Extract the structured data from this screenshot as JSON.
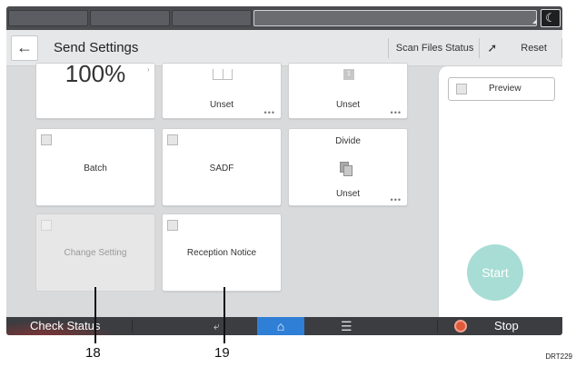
{
  "header": {
    "title": "Send Settings",
    "scan_files_status": "Scan Files Status",
    "reset": "Reset"
  },
  "tiles": {
    "scale": {
      "value": "100%"
    },
    "duplex": {
      "status": "Unset"
    },
    "page_number": {
      "icon_text": "1",
      "status": "Unset"
    },
    "batch": {
      "label": "Batch"
    },
    "sadf": {
      "label": "SADF"
    },
    "divide": {
      "label": "Divide",
      "status": "Unset"
    },
    "change_setting": {
      "label": "Change Setting"
    },
    "reception_notice": {
      "label": "Reception Notice"
    }
  },
  "right_panel": {
    "preview": "Preview",
    "start": "Start"
  },
  "bottom_bar": {
    "check_status": "Check Status",
    "stop": "Stop"
  },
  "callouts": [
    "18",
    "19"
  ],
  "figure_code": "DRT229",
  "colors": {
    "home_accent": "#2f7fd6",
    "start_button": "#a8ddd5",
    "stop_icon": "#e05a3a"
  }
}
